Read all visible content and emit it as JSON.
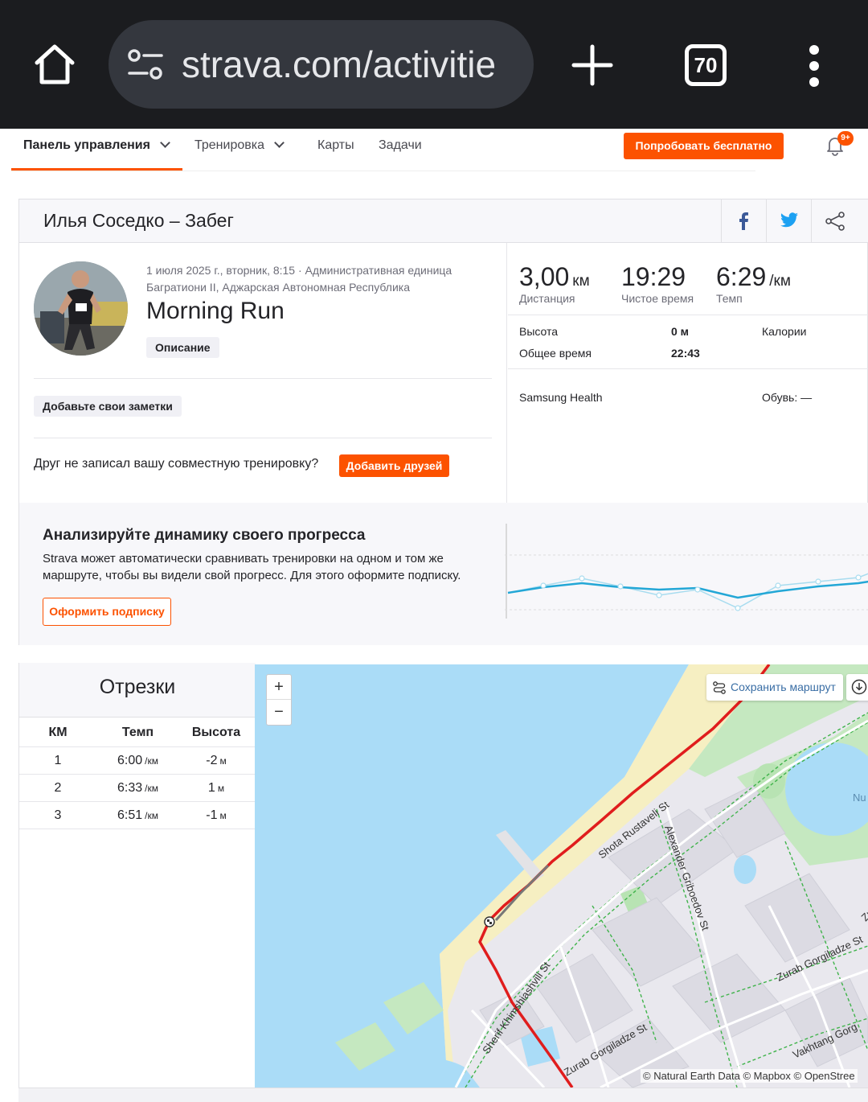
{
  "browser": {
    "url": "strava.com/activitie",
    "tab_count": "70"
  },
  "nav": {
    "dashboard": "Панель управления",
    "training": "Тренировка",
    "maps": "Карты",
    "challenges": "Задачи",
    "try_free": "Попробовать бесплатно",
    "notif_badge": "9+"
  },
  "activity": {
    "header_title": "Илья Соседко – Забег",
    "date_location": "1 июля 2025 г., вторник, 8:15 · Административная единица Багратиони II, Аджарская Автономная Республика",
    "title": "Morning Run",
    "description_chip": "Описание",
    "add_notes_chip": "Добавьте свои заметки",
    "friend_prompt": "Друг не записал вашу совместную тренировку?",
    "add_friends_btn": "Добавить друзей"
  },
  "stats": {
    "distance_value": "3,00",
    "distance_unit": "км",
    "distance_label": "Дистанция",
    "moving_time_value": "19:29",
    "moving_time_label": "Чистое время",
    "pace_value": "6:29",
    "pace_unit": "/км",
    "pace_label": "Темп",
    "elevation_label": "Высота",
    "elevation_value": "0 м",
    "calories_label": "Калории",
    "elapsed_label": "Общее время",
    "elapsed_value": "22:43",
    "device": "Samsung Health",
    "shoes": "Обувь: —"
  },
  "promo": {
    "title": "Анализируйте динамику своего прогресса",
    "text": "Strava может автоматически сравнивать тренировки на одном и том же маршруте, чтобы вы видели свой прогресс. Для этого оформите подписку.",
    "button": "Оформить подписку"
  },
  "splits": {
    "title": "Отрезки",
    "headers": [
      "КМ",
      "Темп",
      "Высота"
    ],
    "rows": [
      {
        "km": "1",
        "pace": "6:00",
        "pace_unit": "/км",
        "elev": "-2",
        "elev_unit": "м"
      },
      {
        "km": "2",
        "pace": "6:33",
        "pace_unit": "/км",
        "elev": "1",
        "elev_unit": "м"
      },
      {
        "km": "3",
        "pace": "6:51",
        "pace_unit": "/км",
        "elev": "-1",
        "elev_unit": "м"
      }
    ]
  },
  "map": {
    "save_route": "Сохранить маршрут",
    "attribution": "© Natural Earth Data © Mapbox © OpenStree",
    "labels": {
      "rustaveli": "Shota Rustaveli St",
      "griboedov": "Alexander Griboedov St",
      "khimshiashvili": "Sherif Khimshiashvili St",
      "gorgiladze1": "Zurab Gorgiladze St",
      "gorgiladze2": "Zurab Gorgiladze St",
      "gorgiladze3": "Zurab Gorgiladze St",
      "vakhtang": "Vakhtang Gorg",
      "nu": "Nu"
    }
  },
  "colors": {
    "accent": "#fc5200",
    "water": "#aadcf7",
    "beach": "#f6efc2",
    "park": "#c5e8c0",
    "route": "#e01d1d"
  }
}
